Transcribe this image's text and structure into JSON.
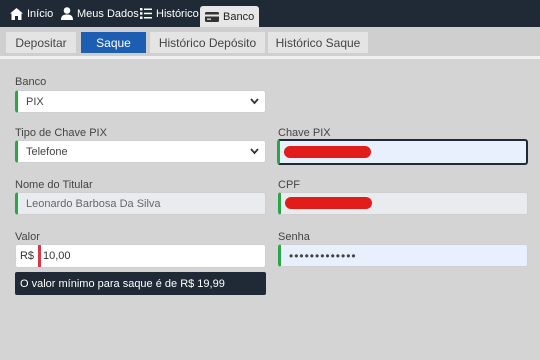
{
  "nav": {
    "items": [
      {
        "label": "Início",
        "icon": "home-icon"
      },
      {
        "label": "Meus Dados",
        "icon": "user-icon"
      },
      {
        "label": "Histórico",
        "icon": "list-icon"
      },
      {
        "label": "Banco",
        "icon": "credit-card-icon",
        "active": true
      }
    ]
  },
  "tabs": [
    {
      "label": "Depositar"
    },
    {
      "label": "Saque",
      "active": true
    },
    {
      "label": "Histórico Depósito"
    },
    {
      "label": "Histórico Saque"
    }
  ],
  "form": {
    "banco": {
      "label": "Banco",
      "value": "PIX"
    },
    "tipo_chave": {
      "label": "Tipo de Chave PIX",
      "value": "Telefone"
    },
    "chave_pix": {
      "label": "Chave PIX",
      "value": ""
    },
    "nome_titular": {
      "label": "Nome do Titular",
      "value": "Leonardo Barbosa Da Silva"
    },
    "cpf": {
      "label": "CPF",
      "value": ""
    },
    "valor": {
      "label": "Valor",
      "prefix": "R$",
      "value": "10,00"
    },
    "senha": {
      "label": "Senha",
      "value": "•••••••••••••"
    }
  },
  "validation": {
    "valor_message": "O valor mínimo para saque é de R$ 19,99"
  },
  "colors": {
    "nav_bg": "#1f2a36",
    "accent": "#1d5eb3",
    "valid": "#28a745",
    "invalid": "#dc3545",
    "redaction": "#e21b1b"
  }
}
